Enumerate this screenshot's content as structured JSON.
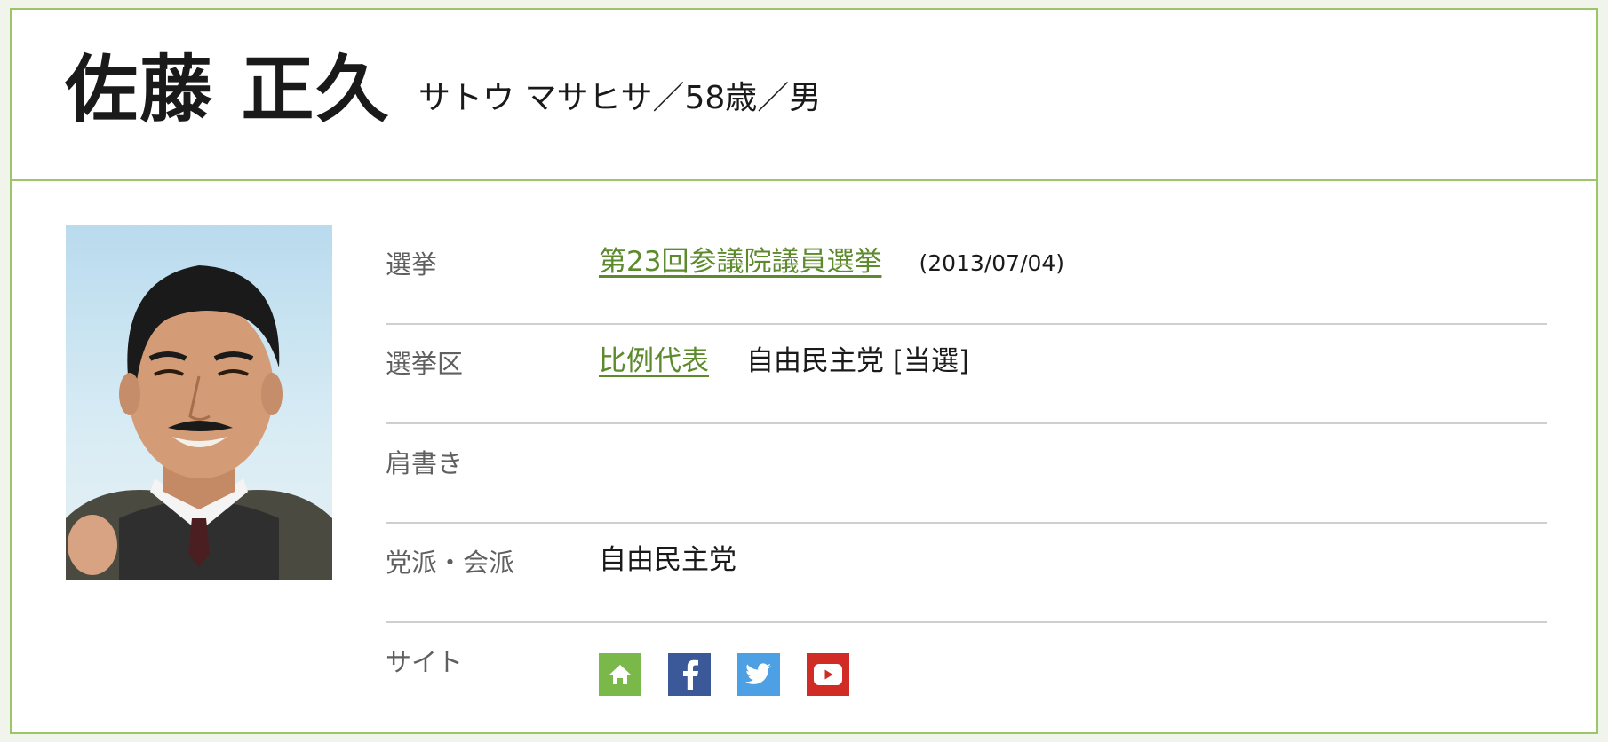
{
  "profile": {
    "name": "佐藤 正久",
    "kana_age_gender": "サトウ マサヒサ／58歳／男"
  },
  "details": {
    "election_label": "選挙",
    "election_link": "第23回参議院議員選挙",
    "election_date": "(2013/07/04)",
    "district_label": "選挙区",
    "district_link": "比例代表",
    "district_result": "自由民主党 [当選]",
    "title_label": "肩書き",
    "title_value": "",
    "party_label": "党派・会派",
    "party_value": "自由民主党",
    "site_label": "サイト"
  },
  "sites": [
    {
      "icon": "home-icon",
      "color": "#7bb84a"
    },
    {
      "icon": "facebook-icon",
      "color": "#3b5998"
    },
    {
      "icon": "twitter-icon",
      "color": "#4ea0e4"
    },
    {
      "icon": "youtube-icon",
      "color": "#d12b26"
    }
  ],
  "colors": {
    "border": "#9cc56a",
    "link": "#5c8a2c",
    "label": "#5f5f5f"
  }
}
